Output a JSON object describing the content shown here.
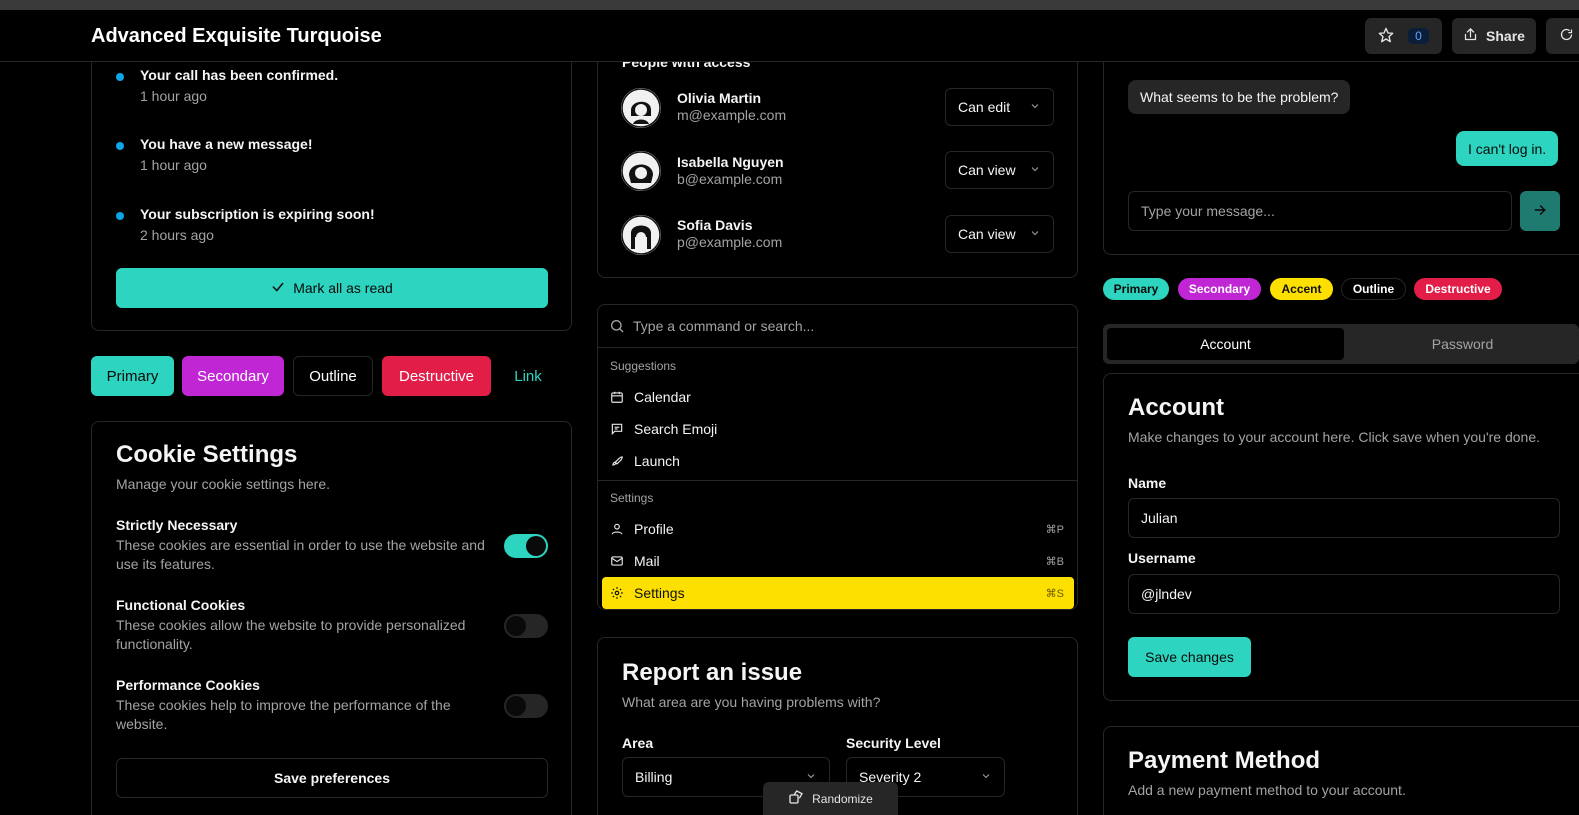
{
  "header": {
    "title": "Advanced Exquisite Turquoise",
    "star_count": "0",
    "share_label": "Share"
  },
  "notifications": [
    {
      "title": "Your call has been confirmed.",
      "time": "1 hour ago"
    },
    {
      "title": "You have a new message!",
      "time": "1 hour ago"
    },
    {
      "title": "Your subscription is expiring soon!",
      "time": "2 hours ago"
    }
  ],
  "mark_all_label": "Mark all as read",
  "buttons": {
    "primary": "Primary",
    "secondary": "Secondary",
    "outline": "Outline",
    "destructive": "Destructive",
    "link": "Link"
  },
  "cookies": {
    "title": "Cookie Settings",
    "subtitle": "Manage your cookie settings here.",
    "items": [
      {
        "title": "Strictly Necessary",
        "desc": "These cookies are essential in order to use the website and use its features.",
        "enabled": true
      },
      {
        "title": "Functional Cookies",
        "desc": "These cookies allow the website to provide personalized functionality.",
        "enabled": false
      },
      {
        "title": "Performance Cookies",
        "desc": "These cookies help to improve the performance of the website.",
        "enabled": false
      }
    ],
    "save_label": "Save preferences"
  },
  "people": {
    "heading": "People with access",
    "list": [
      {
        "name": "Olivia Martin",
        "email": "m@example.com",
        "role": "Can edit"
      },
      {
        "name": "Isabella Nguyen",
        "email": "b@example.com",
        "role": "Can view"
      },
      {
        "name": "Sofia Davis",
        "email": "p@example.com",
        "role": "Can view"
      }
    ]
  },
  "command": {
    "placeholder": "Type a command or search...",
    "suggestions_heading": "Suggestions",
    "suggestions": [
      "Calendar",
      "Search Emoji",
      "Launch"
    ],
    "settings_heading": "Settings",
    "settings": [
      {
        "label": "Profile",
        "shortcut": "⌘P"
      },
      {
        "label": "Mail",
        "shortcut": "⌘B"
      },
      {
        "label": "Settings",
        "shortcut": "⌘S"
      }
    ]
  },
  "issue": {
    "title": "Report an issue",
    "subtitle": "What area are you having problems with?",
    "area_label": "Area",
    "area_value": "Billing",
    "security_label": "Security Level",
    "security_value": "Severity 2"
  },
  "randomize_label": "Randomize",
  "chat": {
    "incoming": "What seems to be the problem?",
    "outgoing": "I can't log in.",
    "placeholder": "Type your message..."
  },
  "badges": {
    "primary": "Primary",
    "secondary": "Secondary",
    "accent": "Accent",
    "outline": "Outline",
    "destructive": "Destructive"
  },
  "tabs": {
    "account": "Account",
    "password": "Password"
  },
  "account": {
    "title": "Account",
    "subtitle": "Make changes to your account here. Click save when you're done.",
    "name_label": "Name",
    "name_value": "Julian",
    "username_label": "Username",
    "username_value": "@jlndev",
    "save_label": "Save changes"
  },
  "payment": {
    "title": "Payment Method",
    "subtitle": "Add a new payment method to your account."
  },
  "colors": {
    "accent_teal": "#2dd4bf",
    "secondary_purple": "#c026d3",
    "destructive_red": "#e11d48",
    "accent_yellow": "#fde000",
    "notification_dot": "#0ea5e9"
  }
}
